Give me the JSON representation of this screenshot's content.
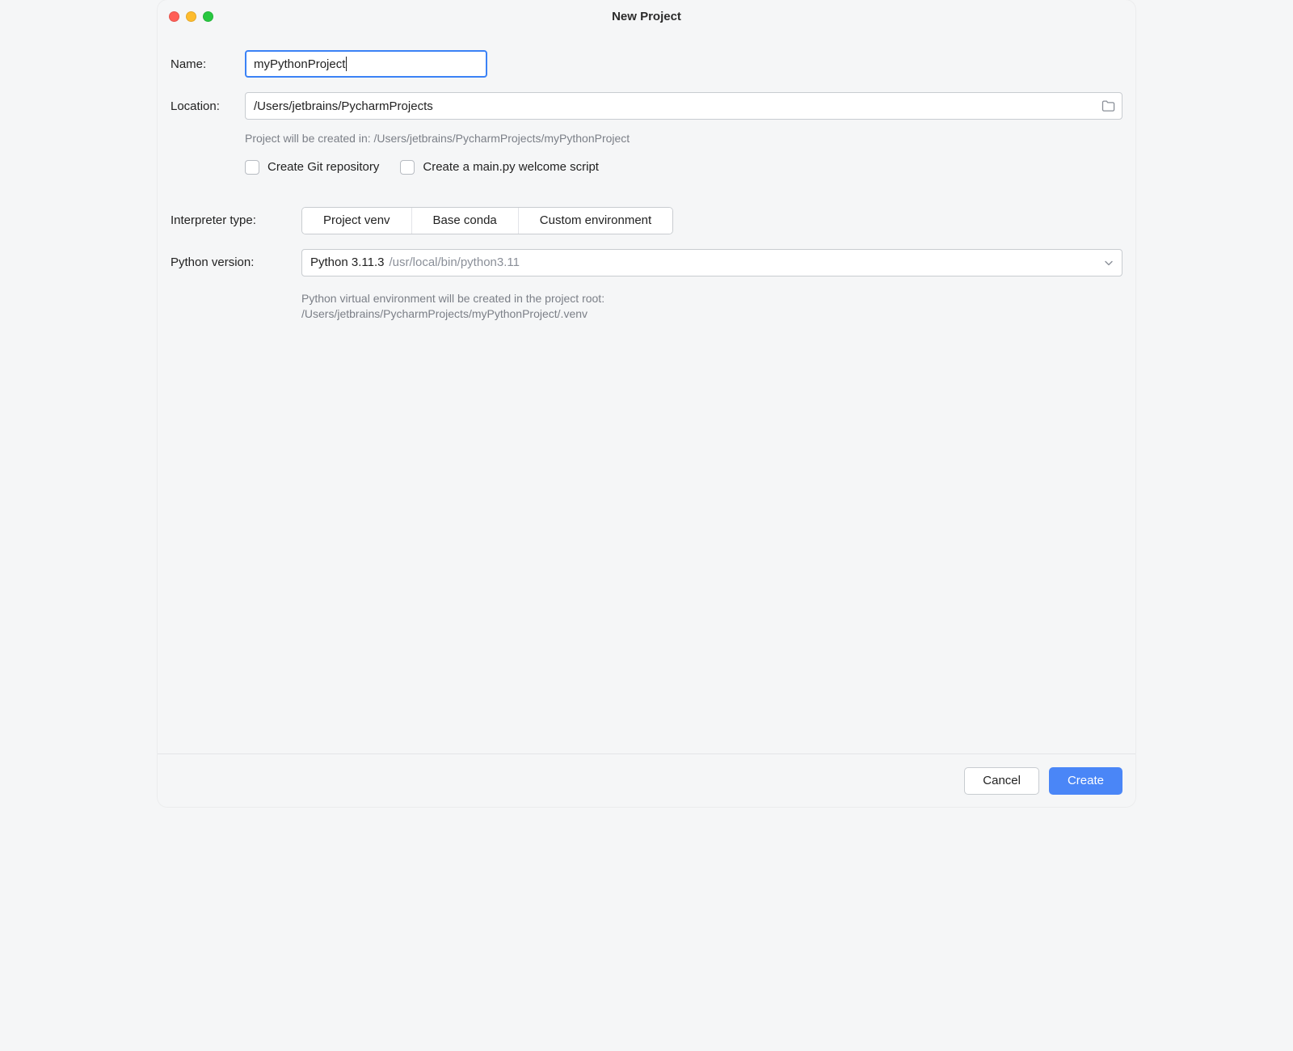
{
  "window": {
    "title": "New Project"
  },
  "form": {
    "name_label": "Name:",
    "name_value": "myPythonProject",
    "location_label": "Location:",
    "location_value": "/Users/jetbrains/PycharmProjects",
    "location_hint": "Project will be created in: /Users/jetbrains/PycharmProjects/myPythonProject",
    "checkbox_git": "Create Git repository",
    "checkbox_main": "Create a main.py welcome script",
    "interpreter_label": "Interpreter type:",
    "interpreter_options": {
      "venv": "Project venv",
      "conda": "Base conda",
      "custom": "Custom environment"
    },
    "python_label": "Python version:",
    "python_value": "Python 3.11.3",
    "python_path": "/usr/local/bin/python3.11",
    "venv_hint_line1": "Python virtual environment will be created in the project root:",
    "venv_hint_line2": "/Users/jetbrains/PycharmProjects/myPythonProject/.venv"
  },
  "footer": {
    "cancel": "Cancel",
    "create": "Create"
  }
}
